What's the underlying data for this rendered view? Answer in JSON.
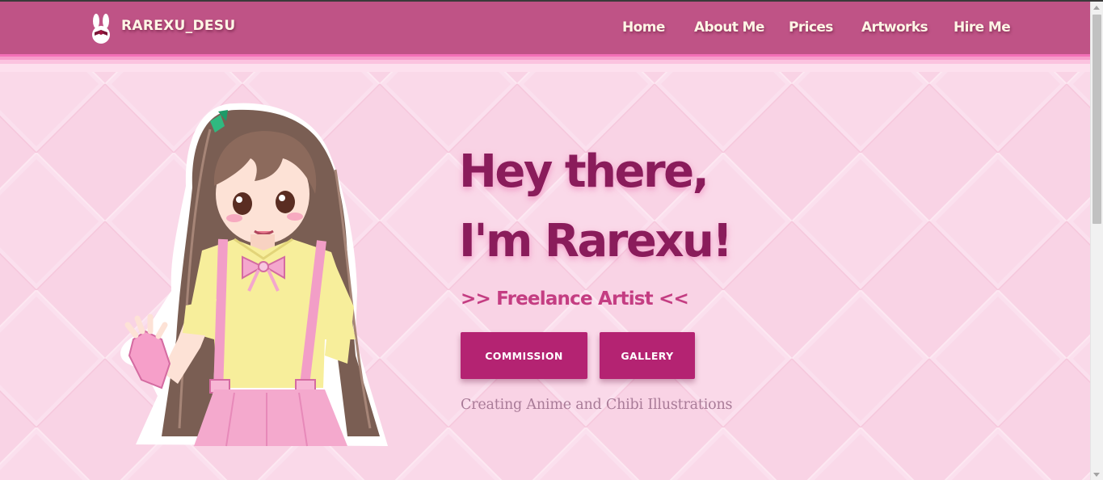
{
  "header": {
    "brand": "RAREXU_DESU",
    "logo_icon": "bunny-icon",
    "nav": [
      "Home",
      "About Me",
      "Prices",
      "Artworks",
      "Hire Me"
    ]
  },
  "hero": {
    "headline_line1": "Hey there,",
    "headline_line2": "I'm Rarexu!",
    "subtitle": ">> Freelance Artist <<",
    "buttons": {
      "commission": "COMMISSION",
      "gallery": "GALLERY"
    },
    "tagline": "Creating Anime and Chibi Illustrations",
    "illustration": "anime-girl-character-illustration"
  },
  "colors": {
    "navbar": "#bf5386",
    "accent": "#b42372",
    "headline": "#8a1c5b",
    "subtitle": "#c43d82",
    "background": "#f9d6e6"
  }
}
